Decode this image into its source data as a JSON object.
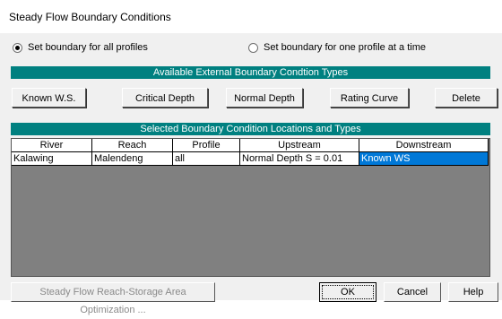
{
  "window": {
    "title": "Steady Flow Boundary Conditions"
  },
  "radios": [
    {
      "label": "Set boundary for all profiles",
      "checked": true
    },
    {
      "label": "Set boundary for one profile at a time",
      "checked": false
    }
  ],
  "bands": {
    "available": "Available External Boundary Condtion Types",
    "selected": "Selected Boundary Condition Locations and Types"
  },
  "buttons": {
    "known_ws": "Known W.S.",
    "critical_depth": "Critical Depth",
    "normal_depth": "Normal Depth",
    "rating_curve": "Rating Curve",
    "delete": "Delete"
  },
  "table": {
    "headers": [
      "River",
      "Reach",
      "Profile",
      "Upstream",
      "Downstream"
    ],
    "rows": [
      [
        "Kalawing",
        "Malendeng",
        "all",
        "Normal Depth S = 0.01",
        "Known WS"
      ]
    ]
  },
  "bottom": {
    "optimization": "Steady Flow Reach-Storage Area Optimization ...",
    "ok": "OK",
    "cancel": "Cancel",
    "help": "Help"
  },
  "colors": {
    "band": "#008080",
    "selection": "#0078d7"
  }
}
